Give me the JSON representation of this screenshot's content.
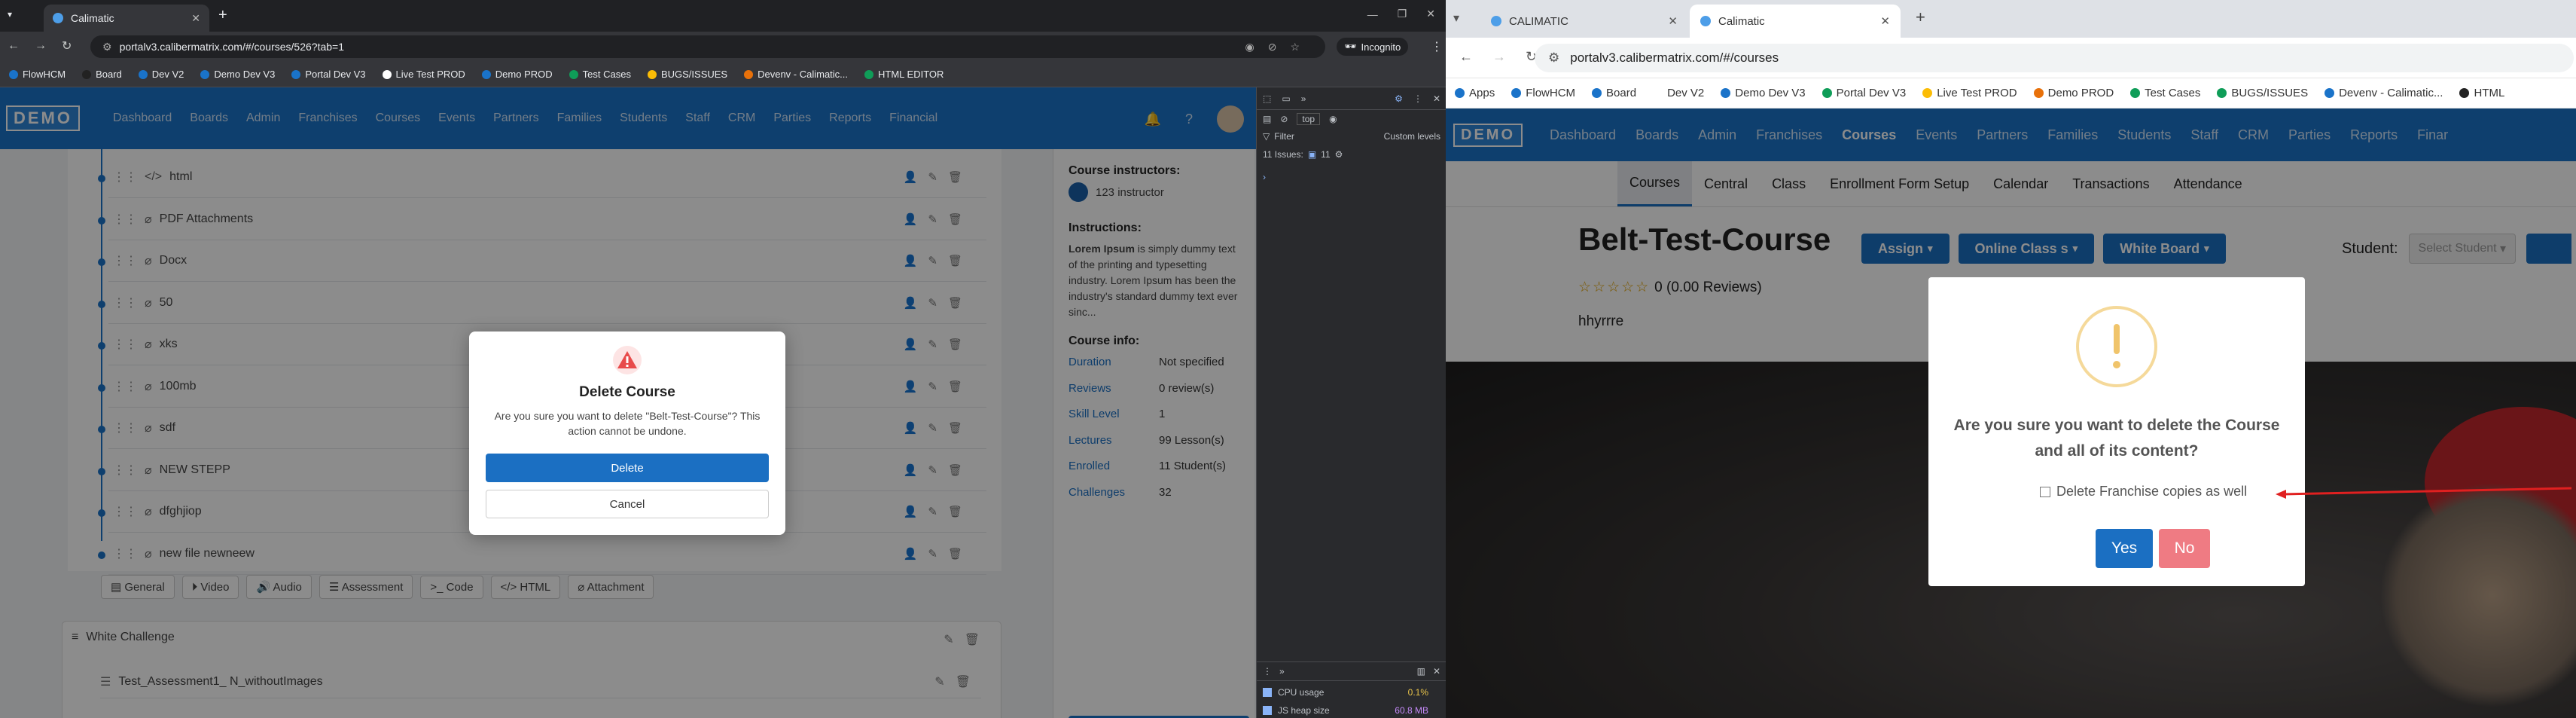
{
  "left": {
    "tab_title": "Calimatic",
    "url": "portalv3.calibermatrix.com/#/courses/526?tab=1",
    "incognito_label": "Incognito",
    "bookmarks": [
      "FlowHCM",
      "Board",
      "Dev V2",
      "Demo Dev V3",
      "Portal Dev V3",
      "Live Test PROD",
      "Demo PROD",
      "Test Cases",
      "BUGS/ISSUES",
      "Devenv - Calimatic...",
      "HTML EDITOR"
    ],
    "logo": "DEMO",
    "nav": [
      "Dashboard",
      "Boards",
      "Admin",
      "Franchises",
      "Courses",
      "Events",
      "Partners",
      "Families",
      "Students",
      "Staff",
      "CRM",
      "Parties",
      "Reports",
      "Financial"
    ],
    "lessons": [
      "html",
      "PDF Attachments",
      "Docx",
      "50",
      "xks",
      "100mb",
      "sdf",
      "NEW STEPP",
      "dfghjiop",
      "new file newneew"
    ],
    "add_buttons": [
      "General",
      "Video",
      "Audio",
      "Assessment",
      "Code",
      "HTML",
      "Attachment"
    ],
    "section_title": "White Challenge",
    "section_item": "Test_Assessment1_ N_withoutImages",
    "instructors_title": "Course instructors:",
    "instructor_name": "123 instructor",
    "instructions_title": "Instructions:",
    "instructions_bold": "Lorem Ipsum",
    "instructions_text": " is simply dummy text of the printing and typesetting industry. Lorem Ipsum has been the industry's standard dummy text ever sinc...",
    "course_info_title": "Course info:",
    "course_info": [
      {
        "k": "Duration",
        "v": "Not specified"
      },
      {
        "k": "Reviews",
        "v": "0 review(s)"
      },
      {
        "k": "Skill Level",
        "v": "1"
      },
      {
        "k": "Lectures",
        "v": "99 Lesson(s)"
      },
      {
        "k": "Enrolled",
        "v": "11 Student(s)"
      },
      {
        "k": "Challenges",
        "v": "32"
      }
    ],
    "modal": {
      "title": "Delete Course",
      "message": "Are you sure you want to delete \"Belt-Test-Course\"? This action cannot be undone.",
      "delete_label": "Delete",
      "cancel_label": "Cancel"
    },
    "devtools": {
      "context": "top",
      "filter_placeholder": "Filter",
      "levels": "Custom levels",
      "issues": "11 Issues:",
      "issues_count": "11",
      "perf": [
        {
          "label": "CPU usage",
          "value": "0.1%"
        },
        {
          "label": "JS heap size",
          "value": "60.8 MB"
        }
      ]
    }
  },
  "right": {
    "tabs": [
      "CALIMATIC",
      "Calimatic"
    ],
    "url": "portalv3.calibermatrix.com/#/courses",
    "bookmarks": [
      "Apps",
      "FlowHCM",
      "Board",
      "Dev V2",
      "Demo Dev V3",
      "Portal Dev V3",
      "Live Test PROD",
      "Demo PROD",
      "Test Cases",
      "BUGS/ISSUES",
      "Devenv - Calimatic...",
      "HTML"
    ],
    "logo": "DEMO",
    "nav": [
      "Dashboard",
      "Boards",
      "Admin",
      "Franchises",
      "Courses",
      "Events",
      "Partners",
      "Families",
      "Students",
      "Staff",
      "CRM",
      "Parties",
      "Reports",
      "Finar"
    ],
    "subnav": [
      "Courses",
      "Central",
      "Class",
      "Enrollment Form Setup",
      "Calendar",
      "Transactions",
      "Attendance"
    ],
    "course_title": "Belt-Test-Course",
    "header_buttons": [
      "Assign",
      "Online Class s",
      "White Board"
    ],
    "student_label": "Student:",
    "student_placeholder": "Select Student",
    "reviews": "0 (0.00 Reviews)",
    "description": "hhyrrre",
    "modal": {
      "question": "Are you sure you want to delete the Course and all of its content?",
      "checkbox_label": "Delete Franchise copies as well",
      "yes_label": "Yes",
      "no_label": "No"
    }
  },
  "colors": {
    "brand": "#1a73c9",
    "danger": "#e84b4b",
    "no_button": "#ef7b83",
    "warning_ring": "#f5d99a"
  }
}
